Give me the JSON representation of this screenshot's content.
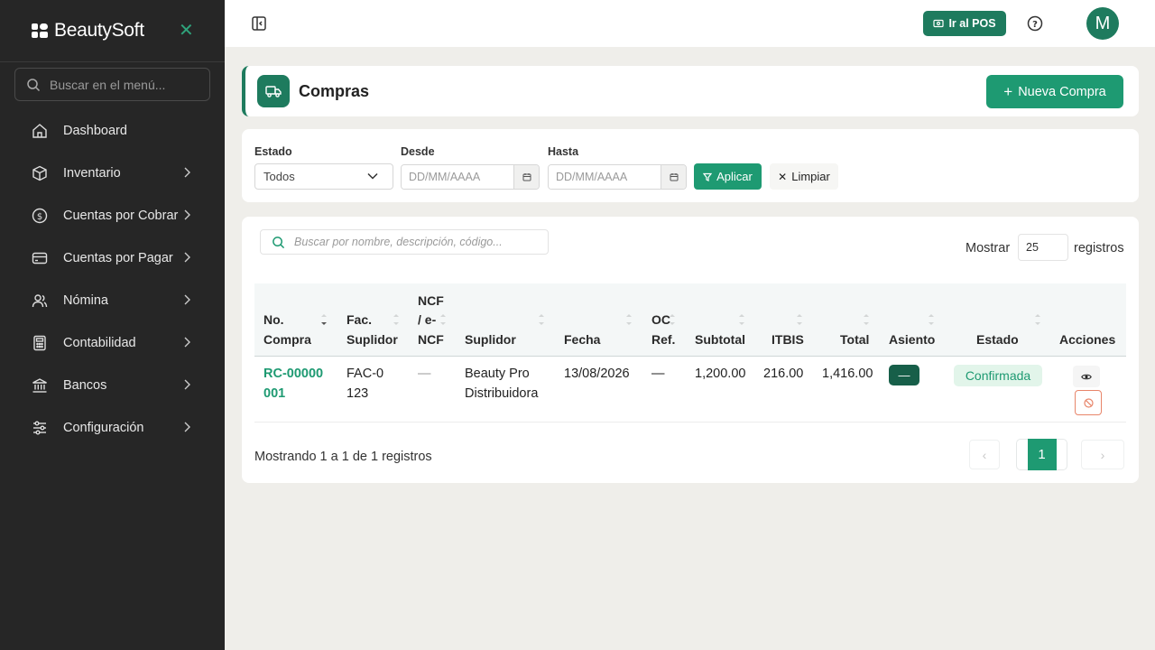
{
  "brand": {
    "name": "BeautySoft"
  },
  "sidebar": {
    "search_placeholder": "Buscar en el menú...",
    "items": [
      {
        "label": "Dashboard",
        "icon": "home-icon"
      },
      {
        "label": "Inventario",
        "icon": "box-icon"
      },
      {
        "label": "Cuentas por Cobrar",
        "icon": "dollar-circle-icon"
      },
      {
        "label": "Cuentas por Pagar",
        "icon": "credit-card-icon"
      },
      {
        "label": "Nómina",
        "icon": "users-icon"
      },
      {
        "label": "Contabilidad",
        "icon": "calculator-icon"
      },
      {
        "label": "Bancos",
        "icon": "bank-icon"
      },
      {
        "label": "Configuración",
        "icon": "sliders-icon"
      }
    ]
  },
  "topbar": {
    "pos_label": "Ir al POS",
    "avatar_initial": "M"
  },
  "header": {
    "title": "Compras",
    "new_label": "Nueva Compra"
  },
  "filters": {
    "estado_label": "Estado",
    "estado_value": "Todos",
    "desde_label": "Desde",
    "hasta_label": "Hasta",
    "date_placeholder": "DD/MM/AAAA",
    "apply_label": "Aplicar",
    "clear_label": "Limpiar"
  },
  "table": {
    "search_placeholder": "Buscar por nombre, descripción, código...",
    "show_label": "Mostrar",
    "page_size": "25",
    "records_label": "registros",
    "columns": [
      "No. Compra",
      "Fac. Suplidor",
      "NCF / e-NCF",
      "Suplidor",
      "Fecha",
      "OC Ref.",
      "Subtotal",
      "ITBIS",
      "Total",
      "Asiento",
      "Estado",
      "Acciones"
    ],
    "rows": [
      {
        "no_compra": "RC-00000001",
        "fac_suplidor": "FAC-0123",
        "ncf": "—",
        "suplidor": "Beauty Pro Distribuidora",
        "fecha": "13/08/2026",
        "oc_ref": "—",
        "subtotal": "1,200.00",
        "itbis": "216.00",
        "total": "1,416.00",
        "asiento": "—",
        "estado": "Confirmada"
      }
    ],
    "footer_info": "Mostrando 1 a 1 de 1 registros",
    "pagination": {
      "prev": "‹",
      "current": "1",
      "next": "›"
    }
  },
  "colors": {
    "sidebar_bg": "#262626",
    "primary": "#1e9a72",
    "primary_dark": "#1e7b5e",
    "danger": "#e8856a"
  }
}
